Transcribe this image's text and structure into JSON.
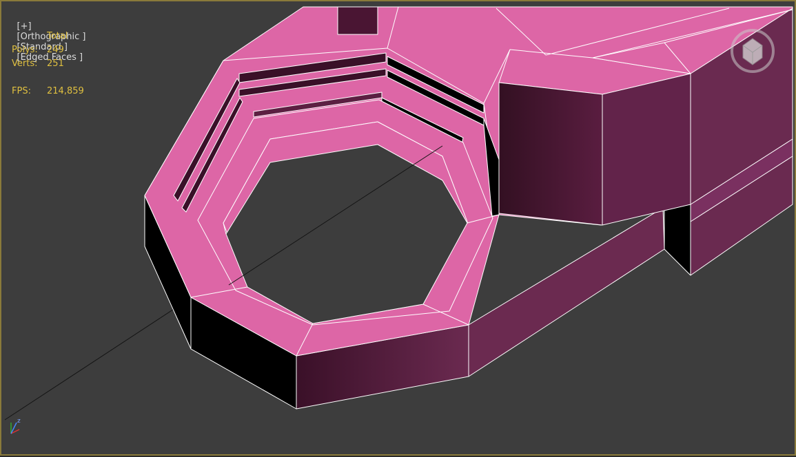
{
  "viewport": {
    "menu_plus": "[+]",
    "menu_view": "[Orthographic ]",
    "menu_shading": "[Standard ]",
    "menu_style": "[Edged Faces ]"
  },
  "stats": {
    "header": "Total",
    "polys_label": "Polys:",
    "polys_value": "249",
    "verts_label": "Verts:",
    "verts_value": "251",
    "fps_label": "FPS:",
    "fps_value": "214,859"
  },
  "colors": {
    "top_face": "#dd66a6",
    "side_face": "#5c1f42",
    "shadow_face": "#000000",
    "viewport_bg": "#3d3d3d",
    "stat_text": "#e0c040",
    "border": "#8a7a3a"
  },
  "icons": {
    "viewcube": "viewcube-icon",
    "axis_tripod": "axis-tripod-icon"
  }
}
